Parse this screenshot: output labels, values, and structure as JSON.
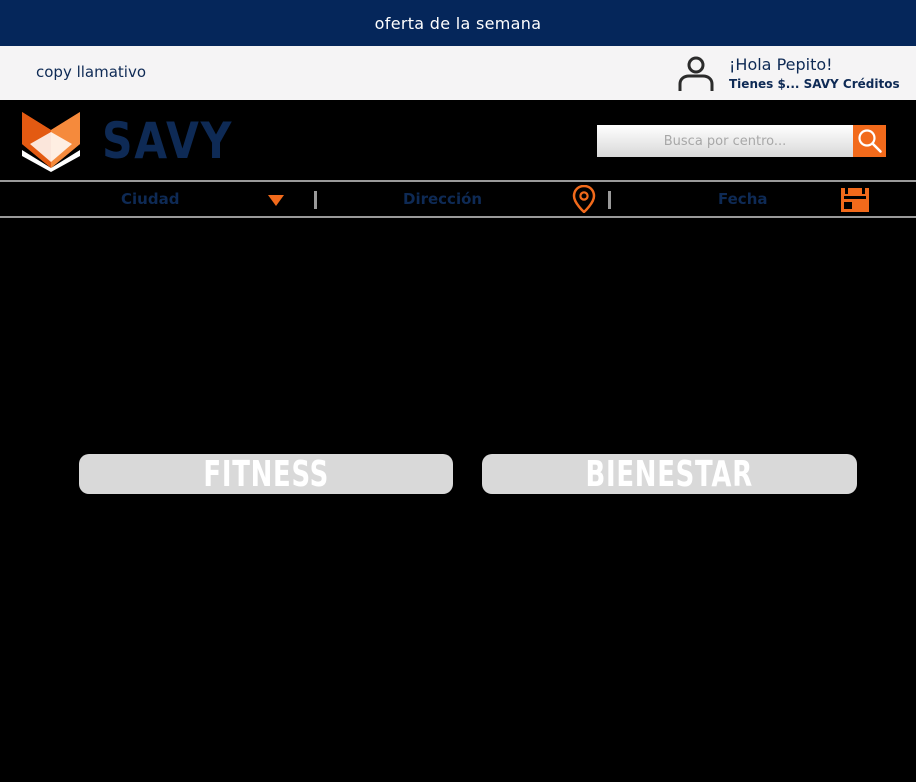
{
  "top_banner": {
    "text": "oferta de la semana"
  },
  "user_bar": {
    "copy": "copy llamativo",
    "greeting": "¡Hola Pepito!",
    "credits": "Tienes $... SAVY Créditos"
  },
  "header": {
    "logo_text": "SAVY",
    "search": {
      "placeholder": "Busca por centro..."
    }
  },
  "filters": {
    "city_label": "Ciudad",
    "address_label": "Dirección",
    "date_label": "Fecha"
  },
  "categories": [
    {
      "label": "FITNESS"
    },
    {
      "label": "BIENESTAR"
    }
  ],
  "colors": {
    "navy": "#05265a",
    "text_navy": "#0e2a55",
    "accent_orange": "#f26a1b",
    "light_bar": "#f5f4f5",
    "category_bg": "#d9d9d9"
  }
}
